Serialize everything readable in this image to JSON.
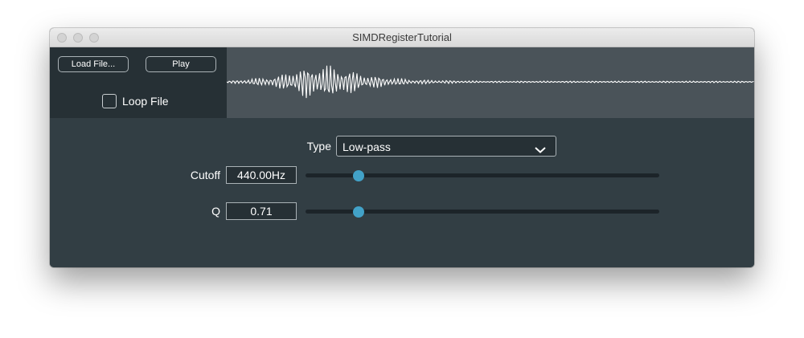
{
  "window": {
    "title": "SIMDRegisterTutorial"
  },
  "controls": {
    "load_file_label": "Load File...",
    "play_label": "Play",
    "loop_file_label": "Loop File",
    "loop_file_checked": false
  },
  "filter": {
    "type_label": "Type",
    "type_value": "Low-pass",
    "cutoff_label": "Cutoff",
    "cutoff_value": "440.00Hz",
    "cutoff_slider_fraction": 0.15,
    "q_label": "Q",
    "q_value": "0.71",
    "q_slider_fraction": 0.15
  },
  "colors": {
    "accent": "#42a2c8",
    "background": "#323e44",
    "waveform": "#ffffff"
  }
}
